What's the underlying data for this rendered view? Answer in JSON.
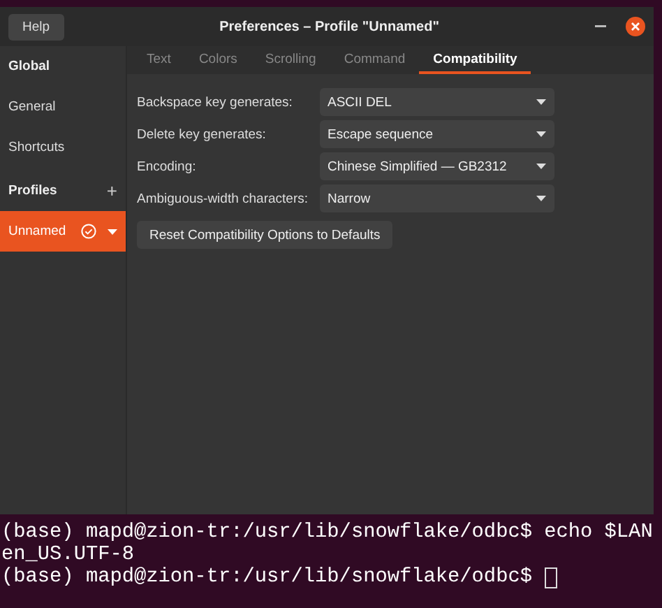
{
  "window": {
    "title": "Preferences – Profile \"Unnamed\"",
    "help_button": "Help"
  },
  "sidebar": {
    "items": [
      {
        "kind": "header",
        "label": "Global",
        "selected": false
      },
      {
        "kind": "item",
        "label": "General",
        "selected": false
      },
      {
        "kind": "item",
        "label": "Shortcuts",
        "selected": false
      },
      {
        "kind": "header",
        "label": "Profiles",
        "add": "+",
        "selected": false
      },
      {
        "kind": "profile",
        "label": "Unnamed",
        "default": true,
        "selected": true
      }
    ]
  },
  "tabs": [
    {
      "label": "Text",
      "selected": false
    },
    {
      "label": "Colors",
      "selected": false
    },
    {
      "label": "Scrolling",
      "selected": false
    },
    {
      "label": "Command",
      "selected": false
    },
    {
      "label": "Compatibility",
      "selected": true
    }
  ],
  "settings": [
    {
      "label": "Backspace key generates:",
      "value": "ASCII DEL"
    },
    {
      "label": "Delete key generates:",
      "value": "Escape sequence"
    },
    {
      "label": "Encoding:",
      "value": "Chinese Simplified — GB2312"
    },
    {
      "label": "Ambiguous-width characters:",
      "value": "Narrow"
    }
  ],
  "reset_button": "Reset Compatibility Options to Defaults",
  "terminal": {
    "lines": [
      {
        "text": "(base) mapd@zion-tr:/usr/lib/snowflake/odbc$ echo $LAN",
        "cursor": false
      },
      {
        "text": "en_US.UTF-8",
        "cursor": false
      },
      {
        "text": "(base) mapd@zion-tr:/usr/lib/snowflake/odbc$ ",
        "cursor": true
      }
    ]
  }
}
